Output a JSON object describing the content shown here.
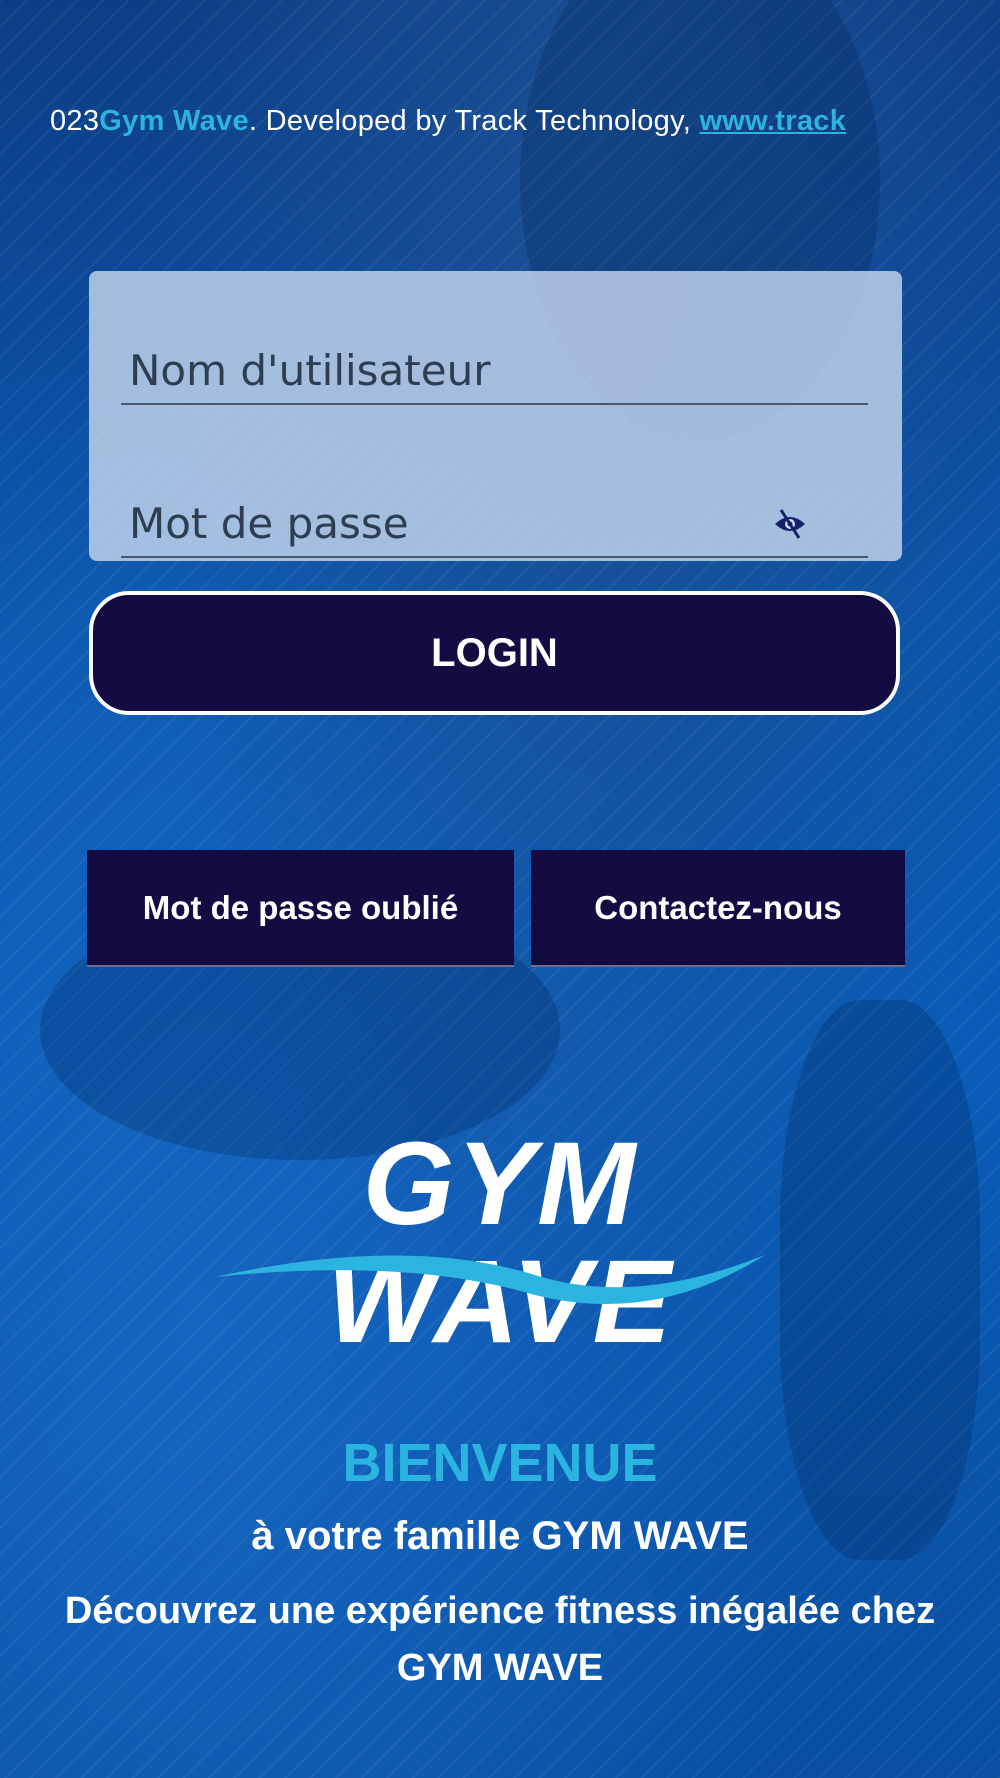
{
  "marquee": {
    "prefix": "023",
    "brand": "Gym Wave",
    "middle": ". Developed by Track Technology, ",
    "link": "www.track"
  },
  "form": {
    "username_placeholder": "Nom d'utilisateur",
    "password_placeholder": "Mot de passe",
    "username_value": "",
    "password_value": ""
  },
  "buttons": {
    "login": "LOGIN",
    "forgot_password": "Mot de passe oublié",
    "contact": "Contactez-nous"
  },
  "logo": {
    "text": "GYM WAVE",
    "wave_color": "#2bb4e0"
  },
  "welcome": {
    "title": "BIENVENUE",
    "subtitle": "à votre famille GYM WAVE",
    "description": "Découvrez une expérience fitness inégalée chez GYM WAVE"
  },
  "colors": {
    "background": "#0a4fa0",
    "accent": "#2bb4e0",
    "button_dark": "#120c42"
  }
}
